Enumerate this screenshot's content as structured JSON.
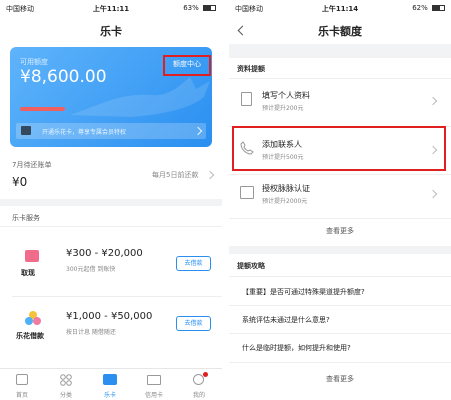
{
  "left": {
    "status": {
      "carrier": "中国移动",
      "time": "上午11:11",
      "battery": "63%",
      "battery_level": 0.63
    },
    "nav_title": "乐卡",
    "card": {
      "label": "可用额度",
      "amount": "¥8,600.00",
      "center_link": "额度中心",
      "promo_text": "开通乐花卡，尊享专属会员特权"
    },
    "bill": {
      "title": "7月待还账单",
      "amount": "¥0",
      "due": "每月5日前还款"
    },
    "services": {
      "title": "乐卡服务",
      "items": [
        {
          "name": "取现",
          "range": "¥300 - ¥20,000",
          "desc": "300元起借  到账快",
          "button": "去借款",
          "icon": "cash-icon"
        },
        {
          "name": "乐花借款",
          "range": "¥1,000 - ¥50,000",
          "desc": "按日计息  随借随还",
          "button": "去借款",
          "icon": "flower-icon"
        }
      ]
    },
    "tabbar": [
      {
        "label": "首页",
        "icon": "home-icon"
      },
      {
        "label": "分类",
        "icon": "grid-icon"
      },
      {
        "label": "乐卡",
        "icon": "card-icon"
      },
      {
        "label": "信用卡",
        "icon": "credit-card-icon"
      },
      {
        "label": "我的",
        "icon": "user-icon"
      }
    ],
    "accent": "#1e8cf0"
  },
  "right": {
    "status": {
      "carrier": "中国移动",
      "time": "上午11:14",
      "battery": "62%",
      "battery_level": 0.62
    },
    "nav_title": "乐卡额度",
    "raise_section": {
      "title": "资料提额",
      "items": [
        {
          "title": "填写个人资料",
          "sub": "预计提升200元",
          "icon": "document-icon"
        },
        {
          "title": "添加联系人",
          "sub": "预计提升500元",
          "icon": "phone-icon"
        },
        {
          "title": "授权脉脉认证",
          "sub": "预计提升2000元",
          "icon": "id-card-icon"
        }
      ],
      "more": "查看更多"
    },
    "tips_section": {
      "title": "提额攻略",
      "items": [
        "【重要】是否可通过特殊渠道提升额度?",
        "系统评估未通过是什么意思?",
        "什么是临时提额，如何提升和使用?"
      ],
      "more": "查看更多"
    }
  }
}
